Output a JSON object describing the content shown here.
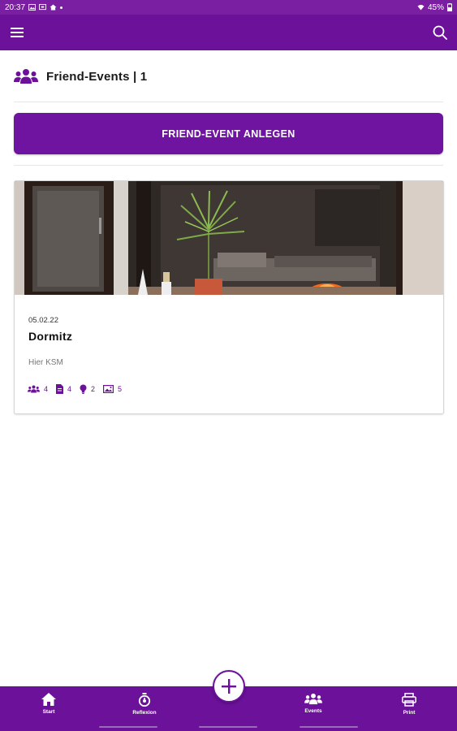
{
  "status_bar": {
    "time": "20:37",
    "battery": "45%",
    "icons": [
      "image-icon",
      "cast-icon",
      "home-icon",
      "dot-icon",
      "wifi-icon",
      "battery-icon"
    ]
  },
  "app_bar": {
    "menu_icon": "hamburger-menu-icon",
    "search_icon": "search-icon"
  },
  "header": {
    "icon": "users-icon",
    "title": "Friend-Events | 1"
  },
  "actions": {
    "create_label": "FRIEND-EVENT ANLEGEN"
  },
  "events": [
    {
      "date": "05.02.22",
      "title": "Dormitz",
      "subtitle": "Hier KSM",
      "stats": [
        {
          "icon": "users-icon",
          "value": "4"
        },
        {
          "icon": "document-icon",
          "value": "4"
        },
        {
          "icon": "lightbulb-icon",
          "value": "2"
        },
        {
          "icon": "image-icon",
          "value": "5"
        }
      ]
    }
  ],
  "bottom_nav": {
    "items": [
      {
        "label": "Start",
        "icon": "home-icon"
      },
      {
        "label": "Reflexion",
        "icon": "stopwatch-icon"
      },
      {
        "label": "Events",
        "icon": "users-icon"
      },
      {
        "label": "Print",
        "icon": "printer-icon"
      }
    ],
    "fab_icon": "plus-icon"
  },
  "colors": {
    "primary": "#6b119a",
    "status_bar": "#7a1fa2",
    "nav_underline": "#9a6cb8"
  }
}
